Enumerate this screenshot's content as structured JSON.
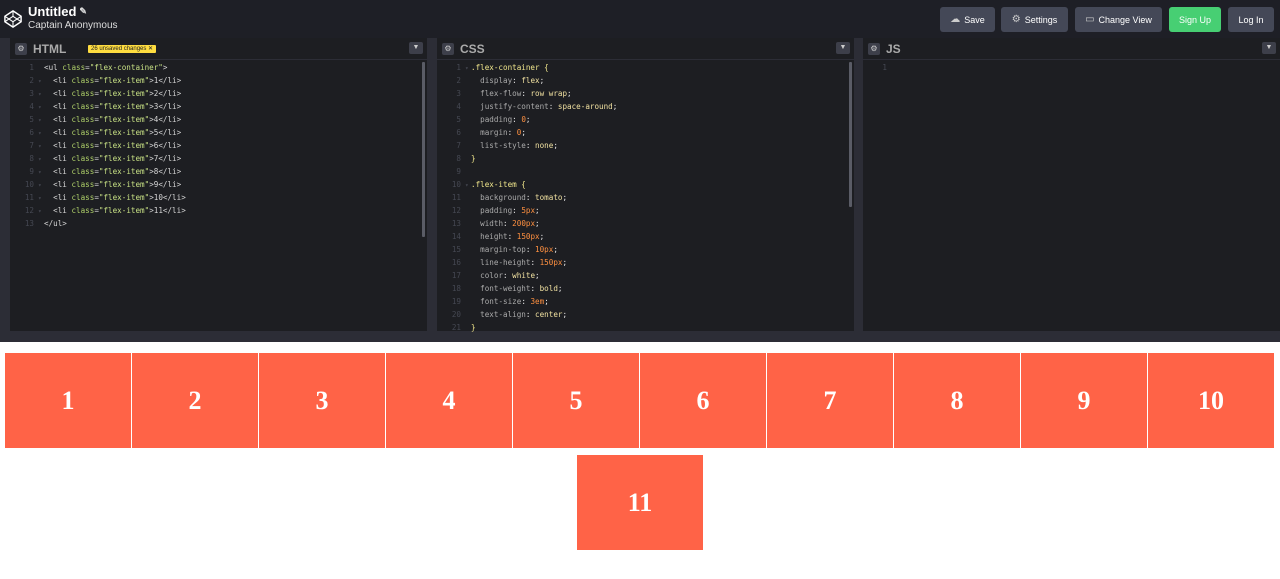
{
  "header": {
    "title": "Untitled",
    "author": "Captain Anonymous",
    "buttons": {
      "save": "Save",
      "settings": "Settings",
      "change_view": "Change View",
      "signup": "Sign Up",
      "login": "Log In"
    }
  },
  "panes": {
    "html": {
      "name": "HTML",
      "badge": "26 unsaved changes ✕",
      "lines": [
        {
          "n": "1",
          "t": "<ul class=\"flex-container\">"
        },
        {
          "n": "2",
          "t": "  <li class=\"flex-item\">1</li>"
        },
        {
          "n": "3",
          "t": "  <li class=\"flex-item\">2</li>"
        },
        {
          "n": "4",
          "t": "  <li class=\"flex-item\">3</li>"
        },
        {
          "n": "5",
          "t": "  <li class=\"flex-item\">4</li>"
        },
        {
          "n": "6",
          "t": "  <li class=\"flex-item\">5</li>"
        },
        {
          "n": "7",
          "t": "  <li class=\"flex-item\">6</li>"
        },
        {
          "n": "8",
          "t": "  <li class=\"flex-item\">7</li>"
        },
        {
          "n": "9",
          "t": "  <li class=\"flex-item\">8</li>"
        },
        {
          "n": "10",
          "t": "  <li class=\"flex-item\">9</li>"
        },
        {
          "n": "11",
          "t": "  <li class=\"flex-item\">10</li>"
        },
        {
          "n": "12",
          "t": "  <li class=\"flex-item\">11</li>"
        },
        {
          "n": "13",
          "t": "</ul>"
        }
      ]
    },
    "css": {
      "name": "CSS",
      "lines": [
        {
          "n": "1",
          "t": ".flex-container {"
        },
        {
          "n": "2",
          "t": "  display: flex;"
        },
        {
          "n": "3",
          "t": "  flex-flow: row wrap;"
        },
        {
          "n": "4",
          "t": "  justify-content: space-around;"
        },
        {
          "n": "5",
          "t": "  padding: 0;"
        },
        {
          "n": "6",
          "t": "  margin: 0;"
        },
        {
          "n": "7",
          "t": "  list-style: none;"
        },
        {
          "n": "8",
          "t": "}"
        },
        {
          "n": "9",
          "t": ""
        },
        {
          "n": "10",
          "t": ".flex-item {"
        },
        {
          "n": "11",
          "t": "  background: tomato;"
        },
        {
          "n": "12",
          "t": "  padding: 5px;"
        },
        {
          "n": "13",
          "t": "  width: 200px;"
        },
        {
          "n": "14",
          "t": "  height: 150px;"
        },
        {
          "n": "15",
          "t": "  margin-top: 10px;"
        },
        {
          "n": "16",
          "t": "  line-height: 150px;"
        },
        {
          "n": "17",
          "t": "  color: white;"
        },
        {
          "n": "18",
          "t": "  font-weight: bold;"
        },
        {
          "n": "19",
          "t": "  font-size: 3em;"
        },
        {
          "n": "20",
          "t": "  text-align: center;"
        },
        {
          "n": "21",
          "t": "}"
        }
      ]
    },
    "js": {
      "name": "JS",
      "lines": [
        {
          "n": "1",
          "t": ""
        }
      ]
    }
  },
  "preview": {
    "items": [
      "1",
      "2",
      "3",
      "4",
      "5",
      "6",
      "7",
      "8",
      "9",
      "10",
      "11"
    ],
    "item_color": "#ff6347"
  }
}
